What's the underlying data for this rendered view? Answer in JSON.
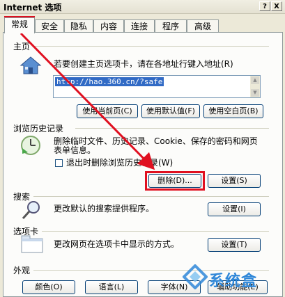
{
  "window": {
    "title": "Internet 选项",
    "help_btn": "?",
    "close_btn": "X"
  },
  "tabs": [
    {
      "label": "常规"
    },
    {
      "label": "安全"
    },
    {
      "label": "隐私"
    },
    {
      "label": "内容"
    },
    {
      "label": "连接"
    },
    {
      "label": "程序"
    },
    {
      "label": "高级"
    }
  ],
  "home": {
    "group": "主页",
    "desc": "若要创建主页选项卡，请在各地址行键入地址(R)",
    "url": "http://hao.360.cn/?safe",
    "btn_current": "使用当前页(C)",
    "btn_default": "使用默认值(F)",
    "btn_blank": "使用空白页(B)"
  },
  "history": {
    "group": "浏览历史记录",
    "desc_line1": "删除临时文件、历史记录、Cookie、保存的密码和网页",
    "desc_line2": "表单信息。",
    "checkbox_label": "退出时删除浏览历史记录(W)",
    "btn_delete": "删除(D)...",
    "btn_settings": "设置(S)"
  },
  "search": {
    "group": "搜索",
    "desc": "更改默认的搜索提供程序。",
    "btn_settings": "设置(I)"
  },
  "tabsec": {
    "group": "选项卡",
    "desc": "更改网页在选项卡中显示的方式。",
    "btn_settings": "设置(T)"
  },
  "appearance": {
    "group": "外观",
    "btn_colors": "颜色(O)",
    "btn_languages": "语言(L)",
    "btn_fonts": "字体(N)",
    "btn_access": "辅助功能(E)"
  },
  "watermark": {
    "text": "系统盒"
  },
  "colors": {
    "highlight": "#e01020",
    "selection": "#316ac5"
  }
}
